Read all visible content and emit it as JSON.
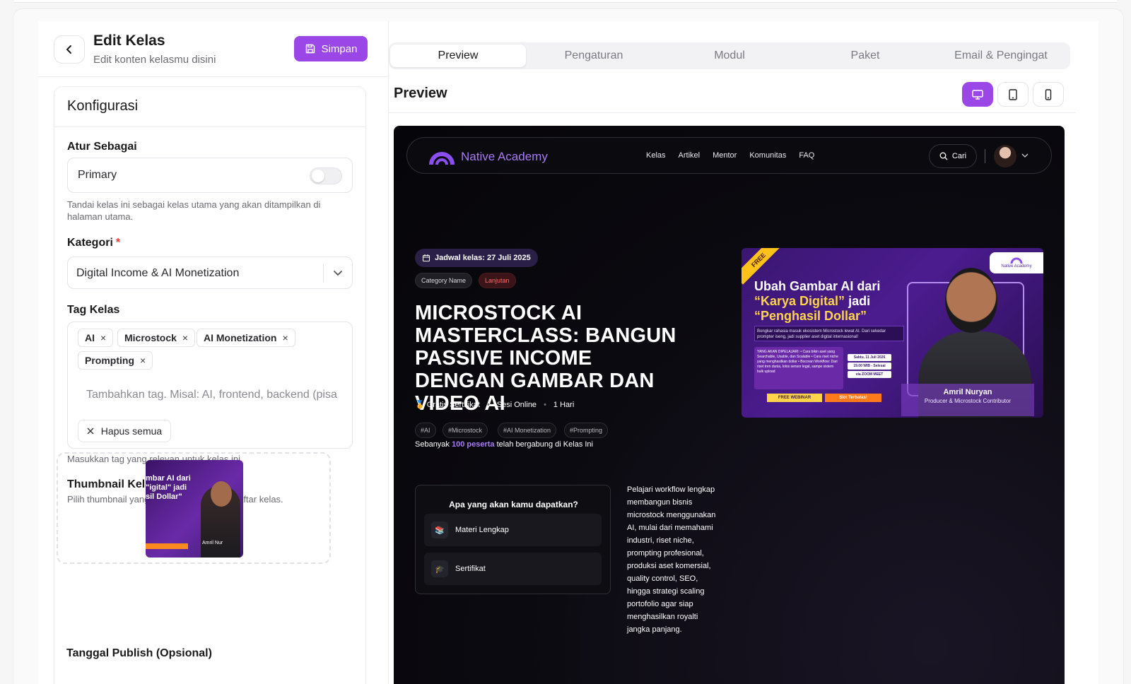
{
  "header": {
    "title": "Edit Kelas",
    "subtitle": "Edit konten kelasmu disini",
    "save_label": "Simpan"
  },
  "config": {
    "title": "Konfigurasi",
    "role_label": "Atur Sebagai",
    "primary_text": "Primary",
    "primary_enabled": false,
    "primary_help": "Tandai kelas ini sebagai kelas utama yang akan ditampilkan di halaman utama.",
    "category_label": "Kategori",
    "category_required": "*",
    "category_value": "Digital Income & AI Monetization",
    "tags_label": "Tag Kelas",
    "tags": [
      "AI",
      "Microstock",
      "AI Monetization",
      "Prompting"
    ],
    "tag_remove_glyph": "×",
    "tag_placeholder": "Tambahkan tag. Misal: AI, frontend, backend (pisa",
    "clear_all_label": "Hapus semua",
    "tags_help": "Masukkan tag yang relevan untuk kelas ini",
    "thumbnail_label": "Thumbnail Kelas",
    "thumbnail_required": "*",
    "thumbnail_help": "Pilih thumbnail yang akan ditampilkan di daftar kelas.",
    "thumbnail_text": "mbar AI dari\n\"igital\" jadi\nsil Dollar\"",
    "thumbnail_name": "Amril Nur",
    "publish_label": "Tanggal Publish (Opsional)"
  },
  "tabs": [
    {
      "label": "Preview",
      "active": true
    },
    {
      "label": "Pengaturan",
      "active": false
    },
    {
      "label": "Modul",
      "active": false
    },
    {
      "label": "Paket",
      "active": false
    },
    {
      "label": "Email & Pengingat",
      "active": false
    }
  ],
  "preview": {
    "title": "Preview",
    "active_device": "desktop",
    "devices": [
      "desktop-icon",
      "tablet-icon",
      "mobile-icon"
    ]
  },
  "site": {
    "brand": "Native Academy",
    "nav": [
      "Kelas",
      "Artikel",
      "Mentor",
      "Komunitas",
      "FAQ"
    ],
    "search_label": "Cari",
    "schedule": "Jadwal kelas: 27 Juli 2025",
    "category": "Category Name",
    "level": "Lanjutan",
    "course_title": "MICROSTOCK AI MASTERCLASS: BANGUN PASSIVE INCOME DENGAN GAMBAR DAN VIDEO AI",
    "meta": [
      "🏅 Gratis Sertifikat",
      "Sesi Online",
      "1 Hari"
    ],
    "meta_separator": "•",
    "hashtags": [
      "#AI",
      "#Microstock",
      "#AI Monetization",
      "#Prompting"
    ],
    "join_prefix": "Sebanyak",
    "join_count": "100 peserta",
    "join_suffix": "telah bergabung di Kelas Ini",
    "benefits_title": "Apa yang akan kamu dapatkan?",
    "benefits": [
      {
        "icon": "📚",
        "label": "Materi Lengkap"
      },
      {
        "icon": "🎓",
        "label": "Sertifikat"
      }
    ],
    "description": "Pelajari workflow lengkap membangun bisnis microstock menggunakan AI, mulai dari memahami industri, riset niche, prompting profesional, produksi aset komersial, quality control, SEO, hingga strategi scaling portofolio agar siap menghasilkan royalti jangka panjang."
  },
  "banner": {
    "free": "FREE",
    "logo_text": "Native Academy",
    "headline_1": "Ubah Gambar AI dari",
    "headline_2": "“Karya Digital”",
    "headline_2b": "jadi",
    "headline_3": "“Penghasil Dollar”",
    "sub": "Bongkar rahasia masuk ekosistem Microstock lewat AI. Dari sekedar prompter iseng, jadi supplier aset digital internasional!",
    "learn": "YANG AKAN DIPELAJARI: • Cara bikin aset yang Searchable, Usable, dan Scalable • Cara riset niche yang menghasilkan dollar • Bocoran Workflow: Dari riset tren dunia, lolos sensor legal, sampe sistem bulk upload",
    "sched": [
      "Sabtu, 11 Juli 2026",
      "19.00 WIB - Selesai",
      "via ZOOM MEET"
    ],
    "cta_1": "FREE WEBINAR",
    "cta_2": "Slot Terbatas!",
    "speaker_name": "Amril Nuryan",
    "speaker_role": "Producer & Microstock Contributor"
  },
  "colors": {
    "accent": "#9b47e8",
    "brand": "#a77bf3",
    "site_bg": "#0b0a10"
  }
}
